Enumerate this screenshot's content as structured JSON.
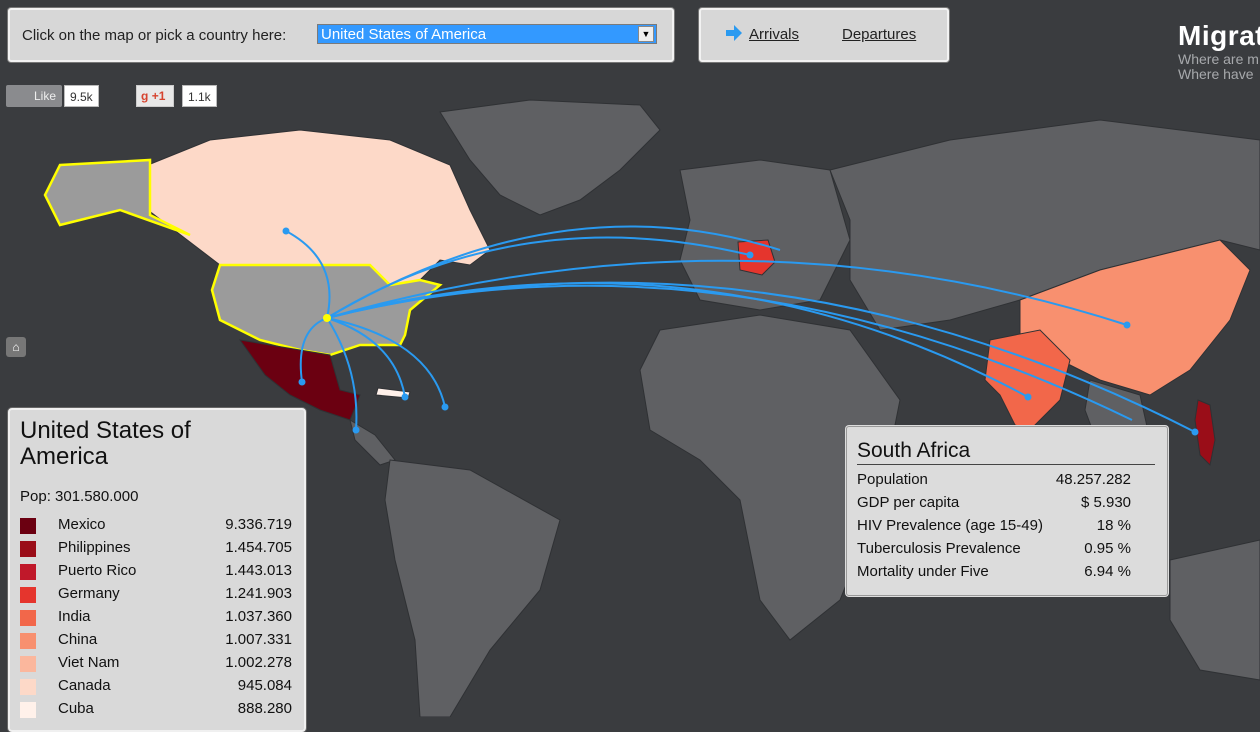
{
  "picker": {
    "label": "Click on the map or pick a country here:",
    "selected": "United States of America"
  },
  "modes": {
    "arrivals": "Arrivals",
    "departures": "Departures"
  },
  "brand": {
    "title": "Migrat",
    "line1": "Where are m",
    "line2": "Where have"
  },
  "social": {
    "like": "Like",
    "like_count": "9.5k",
    "gplus": "+1",
    "gplus_count": "1.1k"
  },
  "info": {
    "country": "United States of America",
    "population": "Pop: 301.580.000",
    "legend": [
      {
        "name": "Mexico",
        "value": "9.336.719",
        "color": "#6b0011"
      },
      {
        "name": "Philippines",
        "value": "1.454.705",
        "color": "#9a0d18"
      },
      {
        "name": "Puerto Rico",
        "value": "1.443.013",
        "color": "#c0182a"
      },
      {
        "name": "Germany",
        "value": "1.241.903",
        "color": "#e5352d"
      },
      {
        "name": "India",
        "value": "1.037.360",
        "color": "#f2674a"
      },
      {
        "name": "China",
        "value": "1.007.331",
        "color": "#f8906f"
      },
      {
        "name": "Viet Nam",
        "value": "1.002.278",
        "color": "#fbb79d"
      },
      {
        "name": "Canada",
        "value": "945.084",
        "color": "#fdd9c8"
      },
      {
        "name": "Cuba",
        "value": "888.280",
        "color": "#fff1ea"
      }
    ]
  },
  "tooltip": {
    "country": "South Africa",
    "rows": [
      {
        "k": "Population",
        "v": "48.257.282"
      },
      {
        "k": "GDP per capita",
        "v": "$ 5.930"
      },
      {
        "k": "HIV Prevalence (age 15-49)",
        "v": "18 %"
      },
      {
        "k": "Tuberculosis Prevalence",
        "v": "0.95 %"
      },
      {
        "k": "Mortality under Five",
        "v": "6.94 %"
      }
    ]
  },
  "colors": {
    "flow": "#2a9af0",
    "highlight": "#ffff00",
    "land": "#5f6063",
    "selected_country": "#9b9b9b"
  }
}
